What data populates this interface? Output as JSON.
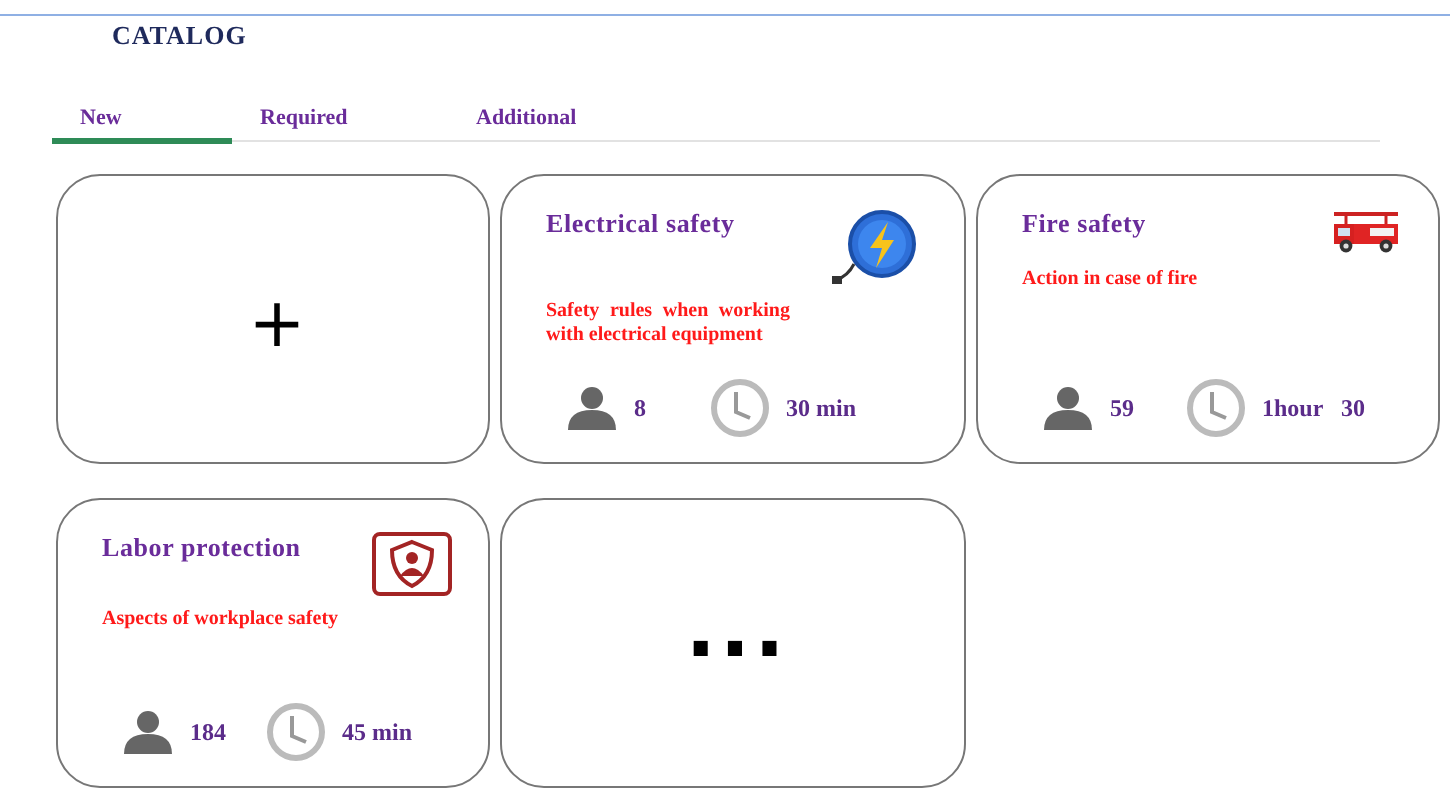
{
  "header": {
    "title": "CATALOG"
  },
  "tabs": [
    {
      "label": "New",
      "selected": true
    },
    {
      "label": "Required",
      "selected": false
    },
    {
      "label": "Additional",
      "selected": false
    }
  ],
  "cards": [
    {
      "kind": "add",
      "symbol": "+"
    },
    {
      "kind": "course",
      "title": "Electrical safety",
      "description": "Safety rules when working with electrical equipment",
      "participants": "8",
      "duration": "30 min"
    },
    {
      "kind": "course",
      "title": "Fire safety",
      "description": "Action in case of fire",
      "participants": "59",
      "duration": "1hour   30"
    },
    {
      "kind": "course",
      "title": "Labor protection",
      "description": "Aspects of workplace safety",
      "participants": "184",
      "duration": "45 min"
    },
    {
      "kind": "more",
      "symbol": "..."
    }
  ]
}
